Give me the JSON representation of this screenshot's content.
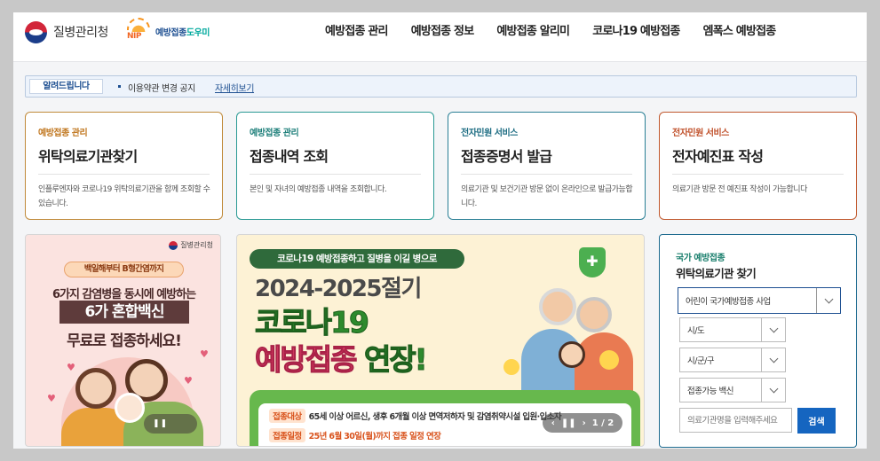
{
  "header": {
    "kdca_name": "질병관리청",
    "nip_logo": {
      "mark": "NIP",
      "text_a": "예방접종",
      "text_b": "도우미"
    },
    "nav": [
      "예방접종 관리",
      "예방접종 정보",
      "예방접종 알리미",
      "코로나19 예방접종",
      "엠폭스 예방접종"
    ]
  },
  "notice": {
    "label": "알려드립니다",
    "text": "이용약관 변경 공지",
    "link": "자세히보기"
  },
  "cards": [
    {
      "category": "예방접종 관리",
      "title": "위탁의료기관찾기",
      "desc": "인플루엔자와 코로나19 위탁의료기관을 함께 조회할 수 있습니다."
    },
    {
      "category": "예방접종 관리",
      "title": "접종내역 조회",
      "desc": "본인 및 자녀의 예방접종 내역을 조회합니다."
    },
    {
      "category": "전자민원 서비스",
      "title": "접종증명서 발급",
      "desc": "의료기관 및 보건기관 방문 없이 온라인으로 발급가능합니다."
    },
    {
      "category": "전자민원 서비스",
      "title": "전자예진표 작성",
      "desc": "의료기관 방문 전 예진표 작성이 가능합니다"
    }
  ],
  "banner1": {
    "org": "질병관리청",
    "pill": "백일해부터 B형간염까지",
    "line1": "6가지 감염병을 동시에 예방하는",
    "box": "6가 혼합백신",
    "line3": "무료로 접종하세요!",
    "pause_icon": "pause-icon"
  },
  "banner2": {
    "pill": "코로나19 예방접종하고 질병을 이길 병으로",
    "year": "2024-2025절기",
    "covid": "코로나19",
    "main_a": "예방접종",
    "main_b": "연장!",
    "row1_tag": "접종대상",
    "row1_text": "65세 이상 어르신, 생후 6개월 이상 면역저하자 및 감염취약시설 입원·입소자",
    "row2_tag": "접종일정",
    "row2_text": "25년 6월 30일(월)까지 접종 일정 연장",
    "counter": "1 / 2"
  },
  "search": {
    "category": "국가 예방접종",
    "title": "위탁의료기관 찾기",
    "program": "어린이 국가예방접종 사업",
    "sido": "시/도",
    "sigungu": "시/군/구",
    "vaccine": "접종가능 백신",
    "placeholder": "의료기관명을 입력해주세요",
    "button": "검색"
  },
  "colors": {
    "primary": "#1d4f91",
    "search_button": "#1565c0"
  }
}
